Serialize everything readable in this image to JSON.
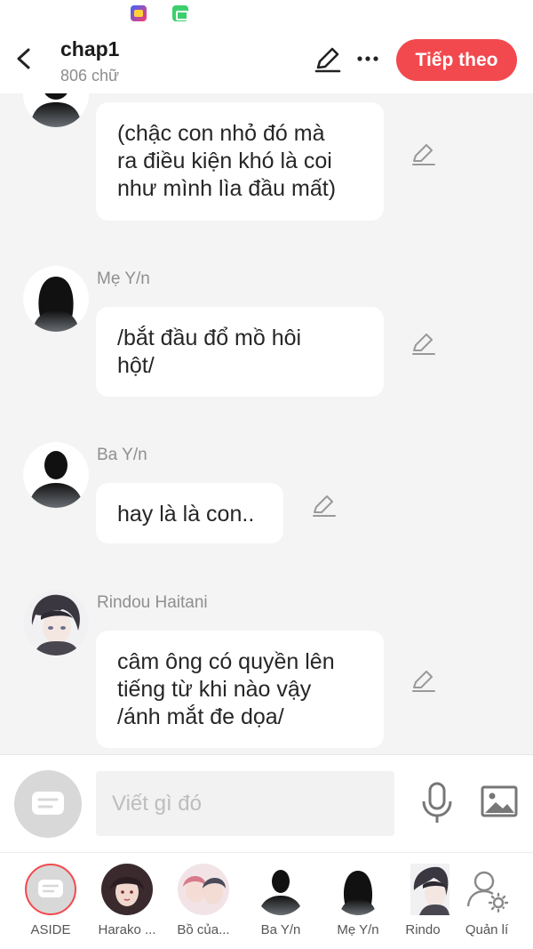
{
  "header": {
    "title": "chap1",
    "word_count": "806 chữ",
    "next_label": "Tiếp theo"
  },
  "messages": [
    {
      "speaker": "",
      "text": "(chậc con nhỏ đó mà\nra điều kiện khó là coi\nnhư mình lìa đầu mất)",
      "avatar": "dark-silhouette-avatar"
    },
    {
      "speaker": "Mẹ Y/n",
      "text": "/bắt đầu đổ mồ hôi\nhột/",
      "avatar": "long-hair-silhouette-avatar"
    },
    {
      "speaker": "Ba Y/n",
      "text": "hay là là con..",
      "avatar": "male-silhouette-avatar"
    },
    {
      "speaker": "Rindou Haitani",
      "text": "câm ông có quyền lên\ntiếng từ khi nào vậy\n/ánh mắt đe dọa/",
      "avatar": "anime-character-avatar"
    }
  ],
  "input": {
    "placeholder": "Viết gì đó"
  },
  "characters": [
    {
      "label": "ASIDE"
    },
    {
      "label": "Harako ..."
    },
    {
      "label": "Bồ của..."
    },
    {
      "label": "Ba Y/n"
    },
    {
      "label": "Mẹ Y/n"
    },
    {
      "label": "Rindo"
    },
    {
      "label": "Quản lí"
    }
  ],
  "colors": {
    "accent": "#f2494e",
    "background": "#f4f4f4",
    "bubble": "#ffffff"
  }
}
